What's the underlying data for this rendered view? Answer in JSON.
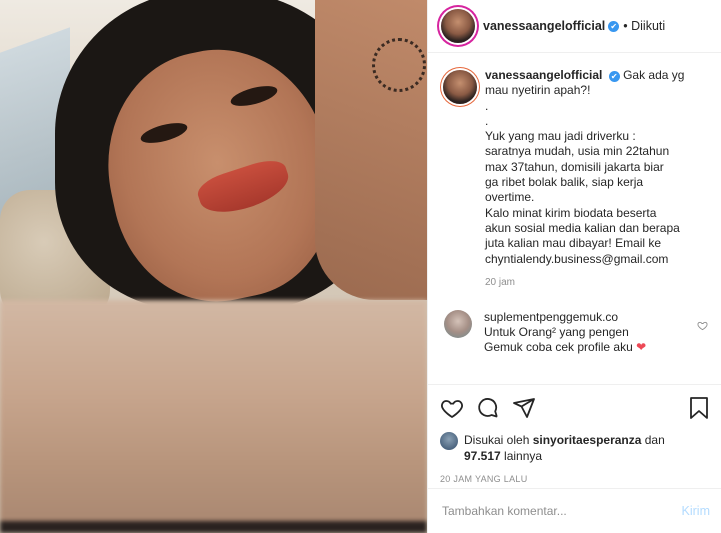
{
  "header": {
    "username": "vanessaangelofficial",
    "verified_badge": "✔",
    "follow_status": "• Diikuti"
  },
  "caption": {
    "username": "vanessaangelofficial",
    "lines": [
      "Gak ada yg",
      "mau nyetirin apah?!",
      ".",
      ".",
      "Yuk yang mau jadi driverku :",
      "saratnya mudah, usia min 22tahun",
      "max 37tahun, domisili jakarta biar",
      "ga ribet bolak balik, siap kerja",
      "overtime.",
      "Kalo minat kirim biodata beserta",
      "akun sosial media kalian dan berapa",
      "juta kalian mau dibayar! Email ke",
      "chyntialendy.business@gmail.com"
    ],
    "time": "20 jam"
  },
  "comment": {
    "username": "suplementpenggemuk.co",
    "line1": "Untuk Orang² yang pengen",
    "line2": "Gemuk coba cek profile aku",
    "emoji": "❤"
  },
  "likes": {
    "prefix": "Disukai oleh ",
    "user": "sinyoritaesperanza",
    "mid": " dan",
    "count": "97.517",
    "suffix": " lainnya"
  },
  "timestamp": "20 JAM YANG LALU",
  "add_comment": {
    "placeholder": "Tambahkan komentar...",
    "post_label": "Kirim"
  },
  "colors": {
    "link_blue": "#3897f0",
    "disabled_post": "#b3dbff",
    "heart_red": "#ed4956"
  }
}
